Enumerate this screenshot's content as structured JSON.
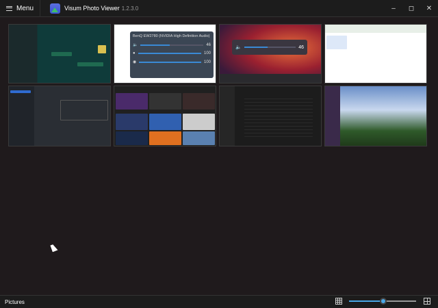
{
  "titlebar": {
    "menu_label": "Menu",
    "app_name": "Visum Photo Viewer",
    "version": "1.2.3.0"
  },
  "thumbnails": [
    {
      "name": "whatsapp-screenshot"
    },
    {
      "name": "sound-mixer-screenshot",
      "device": "BenQ EW2780 (NVIDIA High Definition Audio)",
      "master_volume": "46",
      "app1_volume": "100",
      "app2_volume": "100"
    },
    {
      "name": "volume-flyout-screenshot",
      "volume": "46"
    },
    {
      "name": "explorer-window-screenshot"
    },
    {
      "name": "settings-screenshot"
    },
    {
      "name": "wallpapers-screenshot"
    },
    {
      "name": "file-explorer-screenshot"
    },
    {
      "name": "sky-trees-photo"
    }
  ],
  "statusbar": {
    "folder": "Pictures",
    "zoom_percent": 51
  }
}
